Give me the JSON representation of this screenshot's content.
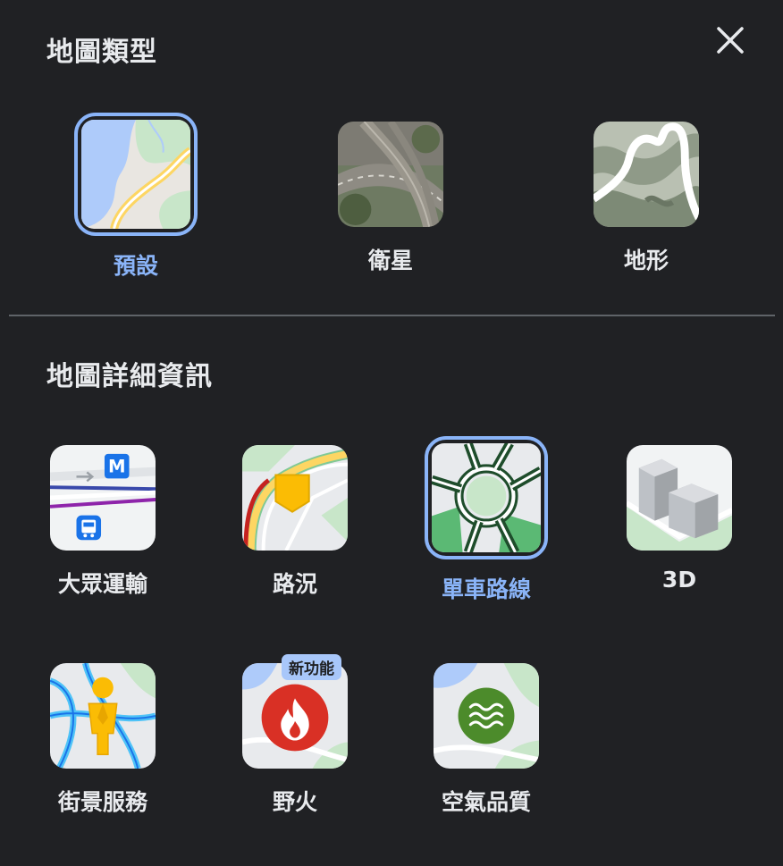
{
  "map_types": {
    "title": "地圖類型",
    "items": [
      {
        "id": "default",
        "label": "預設",
        "selected": true
      },
      {
        "id": "satellite",
        "label": "衛星",
        "selected": false
      },
      {
        "id": "terrain",
        "label": "地形",
        "selected": false
      }
    ]
  },
  "map_details": {
    "title": "地圖詳細資訊",
    "items": [
      {
        "id": "transit",
        "label": "大眾運輸",
        "selected": false
      },
      {
        "id": "traffic",
        "label": "路況",
        "selected": false
      },
      {
        "id": "bicycling",
        "label": "單車路線",
        "selected": true
      },
      {
        "id": "3d",
        "label": "3D",
        "selected": false
      },
      {
        "id": "street_view",
        "label": "街景服務",
        "selected": false
      },
      {
        "id": "wildfires",
        "label": "野火",
        "selected": false,
        "badge": "新功能"
      },
      {
        "id": "air_quality",
        "label": "空氣品質",
        "selected": false
      }
    ]
  },
  "icons": {
    "close": "close-icon",
    "transit_metro_letter": "M"
  },
  "colors": {
    "background": "#202124",
    "accent": "#8ab4f8",
    "badge": "#a8c7fa",
    "divider": "#5f6368"
  }
}
